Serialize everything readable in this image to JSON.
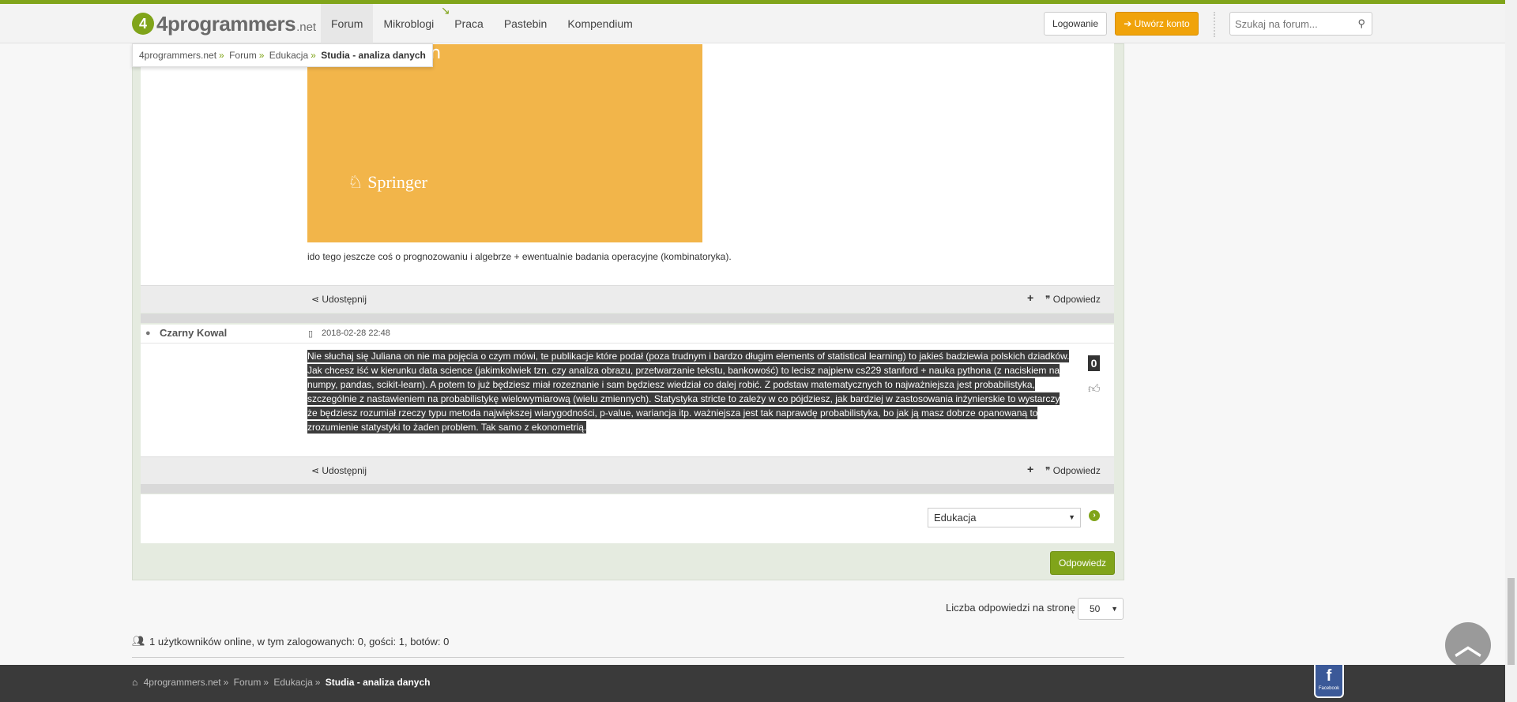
{
  "header": {
    "logo_text": "4programmers",
    "logo_tld": ".net",
    "nav": [
      {
        "label": "Forum"
      },
      {
        "label": "Mikroblogi"
      },
      {
        "label": "Praca"
      },
      {
        "label": "Pastebin"
      },
      {
        "label": "Kompendium"
      }
    ],
    "login_label": "Logowanie",
    "register_label": "Utwórz konto",
    "search_placeholder": "Szukaj na forum..."
  },
  "breadcrumb": {
    "items": [
      "4programmers.net",
      "Forum",
      "Edukacja"
    ],
    "current": "Studia - analiza danych"
  },
  "book": {
    "title_fragment": "tion",
    "publisher": "Springer"
  },
  "post1": {
    "text": "ido tego jeszcze coś o prognozowaniu i algebrze + ewentualnie badania operacyjne (kombinatoryka).",
    "share_label": "Udostępnij",
    "reply_label": "Odpowiedz"
  },
  "post2": {
    "author": "Czarny Kowal",
    "date": "2018-02-28 22:48",
    "text": "Nie słuchaj się Juliana on nie ma pojęcia o czym mówi, te publikacje które podał (poza trudnym i bardzo długim elements of statistical learning) to jakieś badziewia polskich dziadków. Jak chcesz iść w kierunku data science (jakimkolwiek tzn. czy analiza obrazu, przetwarzanie tekstu, bankowość) to lecisz najpierw cs229 stanford + nauka pythona (z naciskiem na numpy, pandas, scikit-learn). A potem to już będziesz miał rozeznanie i sam będziesz wiedział co dalej robić. Z podstaw matematycznych to najważniejsza jest probabilistyka, szczególnie z nastawieniem na probabilistykę wielowymiarową (wielu zmiennych). Statystyka stricte to zależy w co pójdziesz, jak bardziej w zastosowania inżynierskie to wystarczy że będziesz rozumiał rzeczy typu metoda największej wiarygodności, p-value, wariancja itp. ważniejsza jest tak naprawdę probabilistyka, bo jak ją masz dobrze opanowaną to zrozumienie statystyki to żaden problem. Tak samo z ekonometrią.",
    "votes": "0",
    "share_label": "Udostępnij",
    "reply_label": "Odpowiedz"
  },
  "category_select": {
    "value": "Edukacja"
  },
  "reply_button_label": "Odpowiedz",
  "per_page": {
    "label": "Liczba odpowiedzi na stronę",
    "value": "50"
  },
  "online": {
    "text": "1 użytkowników online, w tym zalogowanych: 0, gości: 1, botów: 0"
  },
  "footer": {
    "items": [
      "4programmers.net",
      "Forum",
      "Edukacja"
    ],
    "current": "Studia - analiza danych",
    "facebook_label": "Facebook"
  },
  "colors": {
    "accent": "#80a41a",
    "register": "#f0a30a",
    "book": "#f2b54a"
  }
}
